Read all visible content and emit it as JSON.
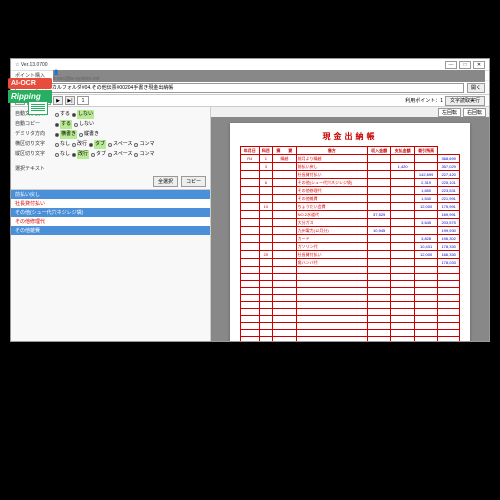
{
  "badge": {
    "ai": "AI-OCR",
    "rip": "Ripping"
  },
  "window": {
    "title": "☆ Ver.13.0700"
  },
  "menu": {
    "item1": "ポイント購入",
    "user": "s-sec@w-system.net"
  },
  "toolbar": {
    "path": "#Desktop#ローカルフォルダ#04.その他伝票#00204手書き現金出納帳",
    "open": "開く"
  },
  "subbar": {
    "page": "1",
    "total": "1",
    "points_label": "利用ポイント：1",
    "exec": "文字読取実行"
  },
  "opts": {
    "auto_read": "自動文字読取",
    "auto_read_o1": "する",
    "auto_read_o2": "しない",
    "auto_copy": "自動コピー",
    "auto_copy_o1": "する",
    "auto_copy_o2": "しない",
    "delim": "デミリタ方向",
    "delim_o1": "横書き",
    "delim_o2": "縦書き",
    "hdelim": "横区切り文字",
    "hdelim_o1": "なし",
    "hdelim_o2": "改行",
    "hdelim_o3": "タブ",
    "hdelim_o4": "スペース",
    "hdelim_o5": "コンマ",
    "vdelim": "縦区切り文字",
    "vdelim_o1": "なし",
    "vdelim_o2": "改行",
    "vdelim_o3": "タブ",
    "vdelim_o4": "スペース",
    "vdelim_o5": "コンマ",
    "sel_label": "選択テキスト"
  },
  "buttons": {
    "all_sel": "全選択",
    "copy": "コピー"
  },
  "list": [
    "前払い戻し",
    "社長貸付払い",
    "その他(シュー代穴ネジレジ袋)",
    "その他修理代",
    "その他雑費"
  ],
  "doc_btns": {
    "rot_l": "左回転",
    "rot_r": "右回転"
  },
  "doc": {
    "title": "現金出納帳"
  },
  "ledger": {
    "head": [
      "年月日",
      "科目",
      "摘　　要",
      "借方",
      "収入金額",
      "支払金額",
      "差引残高"
    ],
    "rows": [
      [
        "R4",
        "1",
        "繰越",
        "前月より繰越",
        "",
        "",
        "",
        "368,699"
      ],
      [
        "",
        "3",
        "",
        "前払い戻し",
        "",
        "1,420",
        "",
        "357,029"
      ],
      [
        "",
        "",
        "",
        "社長貸付払い",
        "",
        "",
        "142,699",
        "227,420"
      ],
      [
        "",
        "6",
        "",
        "その他(シュー代穴ネジレジ袋)",
        "",
        "",
        "2,319",
        "225,101"
      ],
      [
        "",
        "",
        "",
        "その他修理代",
        "",
        "",
        "1,650",
        "223,531"
      ],
      [
        "",
        "",
        "",
        "その他雑費",
        "",
        "",
        "1,540",
        "221,991"
      ],
      [
        "",
        "10",
        "",
        "ちょうだい会費",
        "",
        "",
        "12,000",
        "175,991"
      ],
      [
        "",
        "",
        "",
        "NO.2水道代",
        "37,529",
        "",
        "",
        "169,991"
      ],
      [
        "",
        "",
        "",
        "大分ガス",
        "",
        "",
        "3,645",
        "203,575"
      ],
      [
        "",
        "",
        "",
        "九州電力(12月分)",
        "10,945",
        "",
        "",
        "199,930"
      ],
      [
        "",
        "",
        "",
        "カード",
        "",
        "",
        "3,828",
        "196,302"
      ],
      [
        "",
        "",
        "",
        "ガソリン代",
        "",
        "",
        "10,431",
        "178,330"
      ],
      [
        "",
        "20",
        "",
        "社長貸付払い",
        "",
        "",
        "12,000",
        "166,330"
      ],
      [
        "",
        "",
        "",
        "角ハンバ代",
        "",
        "",
        "",
        "178,033"
      ]
    ]
  }
}
